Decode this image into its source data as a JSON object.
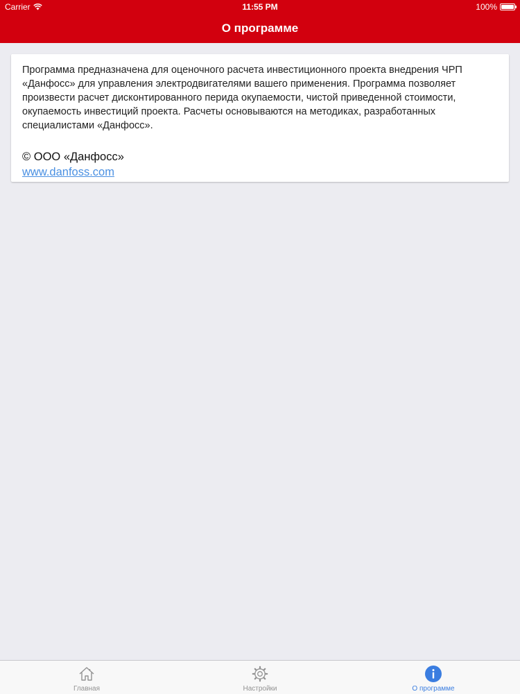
{
  "status_bar": {
    "carrier": "Carrier",
    "time": "11:55 PM",
    "battery": "100%"
  },
  "nav": {
    "title": "О программе"
  },
  "about": {
    "description": "Программа предназначена для оценочного расчета инвестиционного проекта внедрения ЧРП «Данфосс» для управления электродвигателями вашего применения. Программа позволяет произвести расчет дисконтированного перида окупаемости, чистой приведенной стоимости, окупаемость инвестиций проекта. Расчеты основываются на методиках, разработанных специалистами «Данфосс».",
    "copyright": "© ООО «Данфосс»",
    "website": "www.danfoss.com"
  },
  "tabs": [
    {
      "label": "Главная",
      "icon": "home-icon",
      "active": false
    },
    {
      "label": "Настройки",
      "icon": "gear-icon",
      "active": false
    },
    {
      "label": "О программе",
      "icon": "info-icon",
      "active": true
    }
  ],
  "colors": {
    "header": "#d2000e",
    "link": "#4a90e2",
    "active_tab": "#3a7de0"
  }
}
